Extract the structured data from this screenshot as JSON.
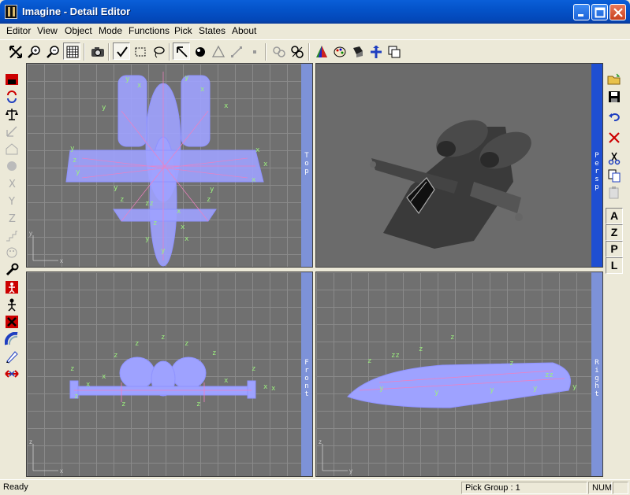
{
  "window": {
    "title": "Imagine - Detail Editor"
  },
  "menu": {
    "items": [
      "Editor",
      "View",
      "Object",
      "Mode",
      "Functions",
      "Pick",
      "States",
      "About"
    ]
  },
  "viewports": {
    "top": {
      "label": "Top"
    },
    "persp": {
      "label": "Persp"
    },
    "front": {
      "label": "Front"
    },
    "right": {
      "label": "Right"
    }
  },
  "right_toolbar": {
    "letters": [
      "A",
      "Z",
      "P",
      "L"
    ]
  },
  "status": {
    "message": "Ready",
    "pick_group": "Pick Group : 1",
    "num": "NUM"
  },
  "colors": {
    "title_bar": "#0453c9",
    "wireframe": "#9ea2ff",
    "axis_marks": "#9cf07e",
    "active_viewport": "#1f4fd2"
  }
}
